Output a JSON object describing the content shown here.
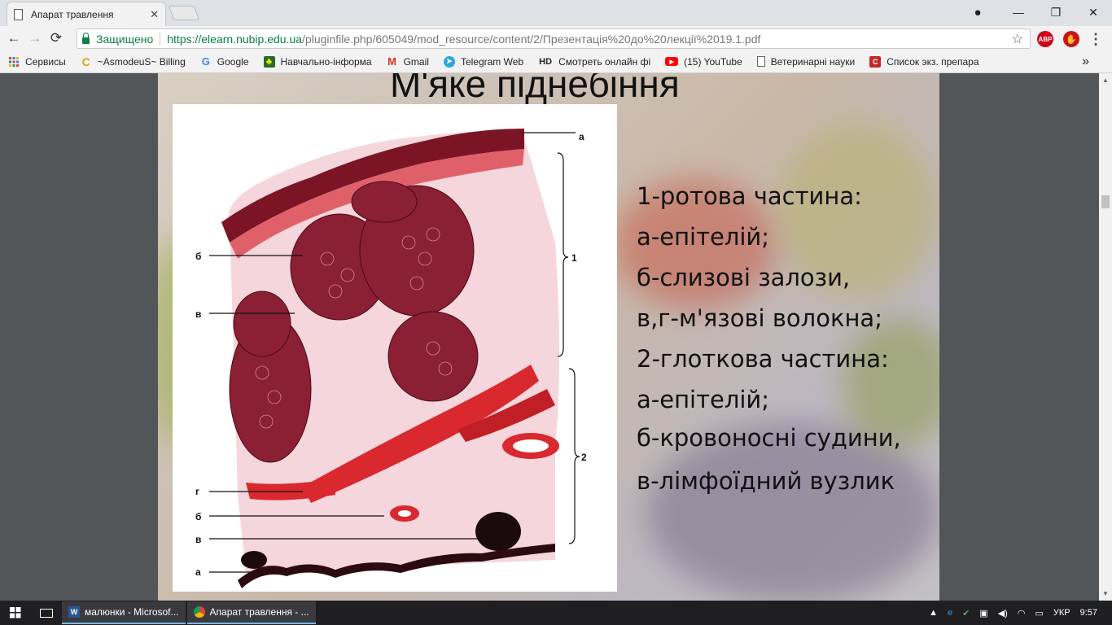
{
  "tab": {
    "title": "Апарат травлення",
    "close": "✕"
  },
  "window": {
    "minimize": "—",
    "restore": "❐",
    "close": "✕"
  },
  "nav": {
    "back": "←",
    "forward": "→",
    "reload": "⟳"
  },
  "omnibox": {
    "secure_label": "Защищено",
    "url_base": "https://elearn.nubip.edu.ua",
    "url_rest": "/pluginfile.php/605049/mod_resource/content/2/Презентація%20до%20лекції%2019.1.pdf",
    "star": "☆"
  },
  "extensions": [
    {
      "name": "abp-icon",
      "label": "ABP",
      "color": "#d0021b"
    },
    {
      "name": "ublock-icon",
      "label": "✋",
      "color": "#c81616"
    }
  ],
  "menu": "⋮",
  "bookmarks": [
    {
      "label": "Сервисы",
      "icon": "apps-icon"
    },
    {
      "label": "~AsmodeuS~ Billing",
      "icon": "billing-icon"
    },
    {
      "label": "Google",
      "icon": "google-icon"
    },
    {
      "label": "Навчально-інформа",
      "icon": "university-icon"
    },
    {
      "label": "Gmail",
      "icon": "gmail-icon"
    },
    {
      "label": "Telegram Web",
      "icon": "telegram-icon"
    },
    {
      "label": "Смотреть онлайн фі",
      "icon": "hd-icon"
    },
    {
      "label": "(15) YouTube",
      "icon": "youtube-icon"
    },
    {
      "label": "Ветеринарні науки",
      "icon": "page-icon"
    },
    {
      "label": "Список экз. препара",
      "icon": "list-icon"
    }
  ],
  "bookmarks_more": "»",
  "slide": {
    "title": "М'яке піднебіння",
    "figure_labels": {
      "a_top": "а",
      "b_top": "б",
      "v_top": "в",
      "one": "1",
      "two": "2",
      "g": "г",
      "b_bottom": "б",
      "v_bottom": "в",
      "a_bottom": "а"
    },
    "lines": [
      "1-ротова частина:",
      "а-епітелій;",
      "б-слизові залози,",
      "в,г-м'язові волокна;",
      "2-глоткова частина:",
      "а-епітелій;",
      "б-кровоносні судини,",
      "в-лімфоїдний вузлик"
    ]
  },
  "taskbar": {
    "tasks": [
      {
        "label": "малюнки - Microsof...",
        "icon": "word-icon"
      },
      {
        "label": "Апарат травлення - ...",
        "icon": "chrome-icon"
      }
    ],
    "lang": "УКР",
    "time": "9:57"
  }
}
